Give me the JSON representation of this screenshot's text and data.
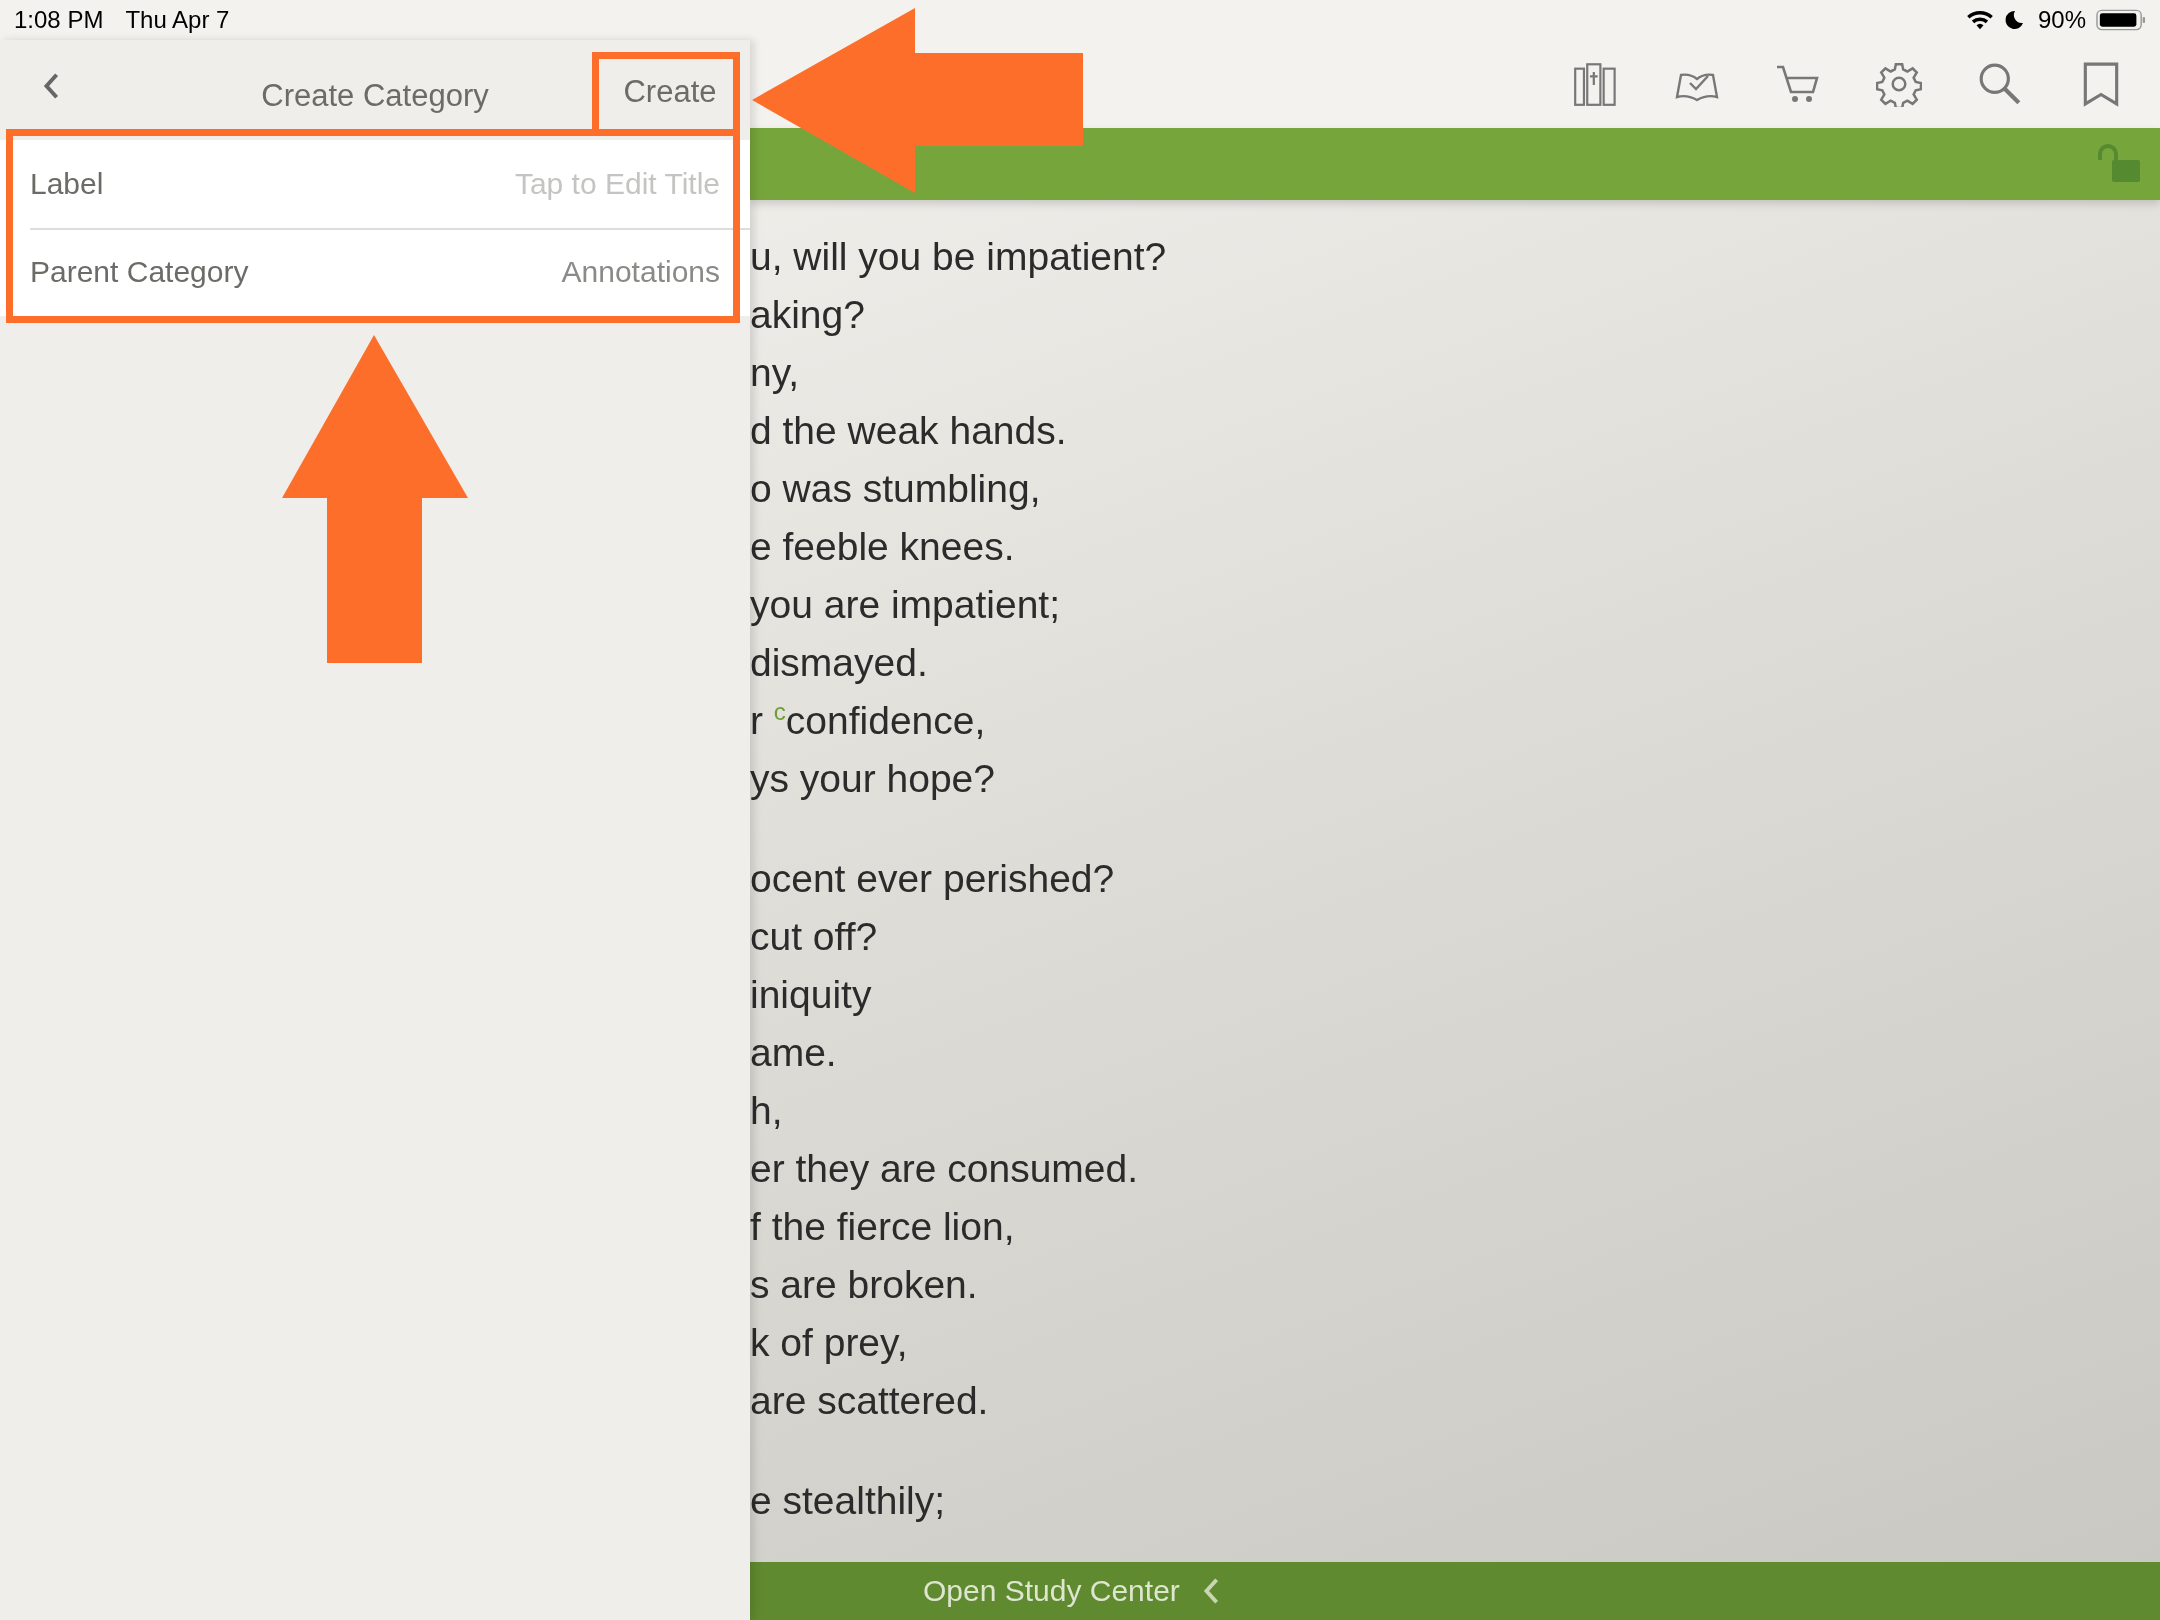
{
  "status_bar": {
    "time": "1:08 PM",
    "date": "Thu Apr 7",
    "battery": "90%"
  },
  "panel": {
    "title": "Create Category",
    "create_button": "Create",
    "fields": [
      {
        "kind": "text-input",
        "label": "Label",
        "placeholder": "Tap to Edit Title"
      },
      {
        "kind": "picker",
        "label": "Parent Category",
        "value": "Annotations"
      }
    ]
  },
  "reader": {
    "stanzas": [
      [
        "u, will you be impatient?",
        "aking?",
        "ny,",
        "d the weak hands.",
        "o was stumbling,",
        "e feeble knees.",
        "you are impatient;",
        "dismayed.",
        "r $^{c}$confidence,",
        "ys your hope?"
      ],
      [
        "ocent ever perished?",
        "cut off?",
        "iniquity",
        "ame.",
        "h,",
        "er they are consumed.",
        "f the fierce lion,",
        "s are broken.",
        "k of prey,",
        "are scattered."
      ],
      [
        "e stealthily;"
      ]
    ]
  },
  "footer": {
    "study_center": "Open Study Center"
  }
}
